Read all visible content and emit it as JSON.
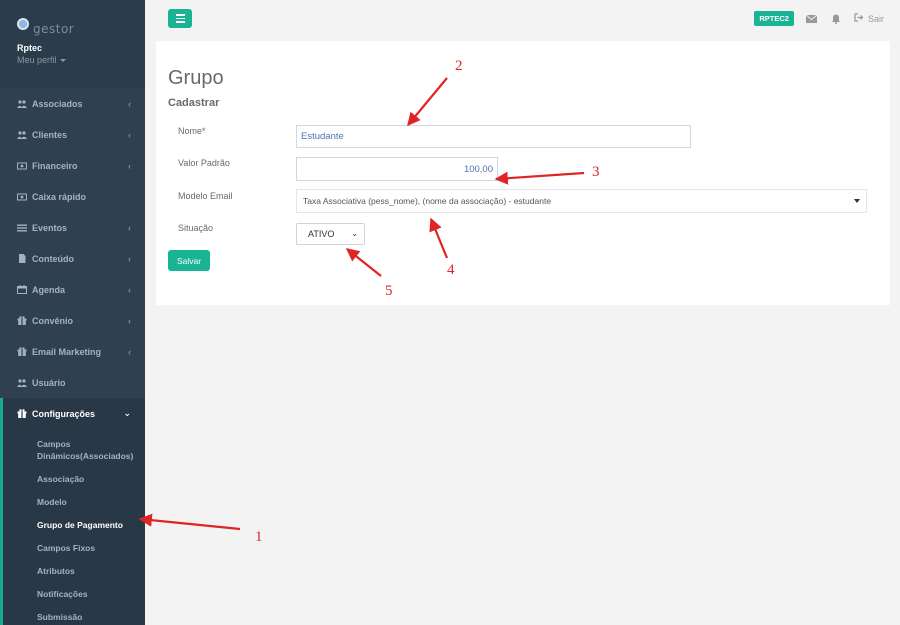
{
  "brand": {
    "logo_text": "gestor",
    "user_name": "Rptec",
    "profile_link": "Meu perfil"
  },
  "sidebar": {
    "items": [
      {
        "label": "Associados",
        "icon": "users-icon"
      },
      {
        "label": "Clientes",
        "icon": "users-icon"
      },
      {
        "label": "Financeiro",
        "icon": "money-icon"
      },
      {
        "label": "Caixa rápido",
        "icon": "money-icon"
      },
      {
        "label": "Eventos",
        "icon": "list-icon"
      },
      {
        "label": "Conteúdo",
        "icon": "file-icon"
      },
      {
        "label": "Agenda",
        "icon": "calendar-icon"
      },
      {
        "label": "Convênio",
        "icon": "gift-icon"
      },
      {
        "label": "Email Marketing",
        "icon": "gift-icon"
      },
      {
        "label": "Usuário",
        "icon": "users-icon"
      }
    ],
    "active": {
      "label": "Configurações",
      "icon": "gift-icon"
    },
    "submenu": [
      "Campos Dinâmicos(Associados)",
      "Associação",
      "Modelo",
      "Grupo de Pagamento",
      "Campos Fixos",
      "Atributos",
      "Notificações",
      "Submissão"
    ]
  },
  "topbar": {
    "org_badge": "RPTEC2",
    "logout_label": "Sair"
  },
  "form": {
    "title": "Grupo",
    "subtitle": "Cadastrar",
    "nome_label": "Nome*",
    "nome_value": "Estudante",
    "valor_label": "Valor Padrão",
    "valor_value": "100,00",
    "modelo_label": "Modelo Email",
    "modelo_value": "Taxa Associativa (pess_nome), (nome da associação) - estudante",
    "situacao_label": "Situação",
    "situacao_value": "ATIVO",
    "save_label": "Salvar"
  },
  "annotations": [
    "1",
    "2",
    "3",
    "4",
    "5"
  ],
  "colors": {
    "sidebar_bg": "#2f4050",
    "accent": "#1ab394",
    "annotation": "#e02424"
  }
}
